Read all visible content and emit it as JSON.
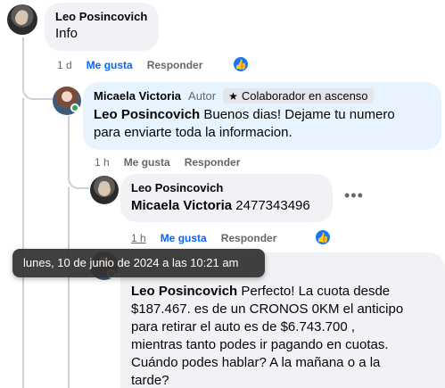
{
  "comments": [
    {
      "author": "Leo Posincovich",
      "text": "Info",
      "time": "1 d",
      "like": "Me gusta",
      "reply": "Responder"
    },
    {
      "author": "Micaela Victoria",
      "badge_author": "Autor",
      "badge_tag": "Colaborador en ascenso",
      "mention": "Leo Posincovich",
      "text_line1": " Buenos dias! Dejame tu numero",
      "text_line2": "para enviarte toda la informacion.",
      "time": "1 h",
      "like": "Me gusta",
      "reply": "Responder"
    },
    {
      "author": "Leo Posincovich",
      "mention": "Micaela Victoria",
      "text": " 2477343496",
      "time": "1 h",
      "like": "Me gusta",
      "reply": "Responder"
    },
    {
      "mention": "Leo Posincovich",
      "text_line1": " Perfecto! La cuota desde",
      "text_line2": "$187.467. es de un CRONOS 0KM el anticipo",
      "text_line3": "para retirar el auto es de $6.743.700 ,",
      "text_line4": "mientras tanto podes ir pagando en cuotas.",
      "text_line5": "Cuándo podes hablar? A la mañana o a la",
      "text_line6": "tarde?"
    }
  ],
  "tooltip": "lunes, 10 de junio de 2024 a las 10:21 am",
  "icons": {
    "like_reaction": "thumbs-up-icon",
    "more": "more-options-icon",
    "star": "star-icon"
  },
  "colors": {
    "link_blue": "#0866ff",
    "bubble_grey": "#f0f2f5",
    "bubble_blue": "#e7f3ff",
    "online_green": "#31a24c"
  }
}
